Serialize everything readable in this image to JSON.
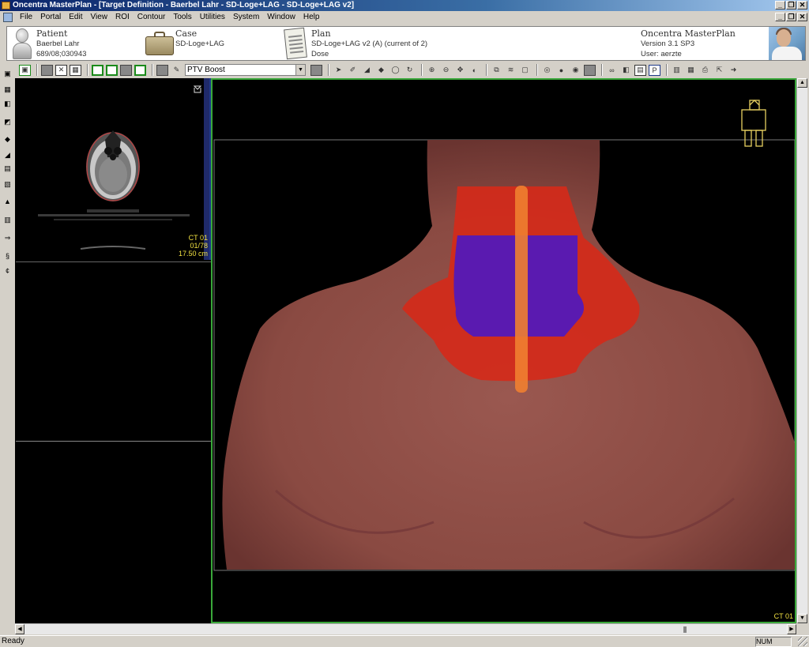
{
  "window": {
    "title": "Oncentra MasterPlan - [Target Definition - Baerbel Lahr - SD-Loge+LAG - SD-Loge+LAG v2]",
    "controls": [
      "_",
      "❐",
      "✕"
    ]
  },
  "menu": {
    "items": [
      "File",
      "Portal",
      "Edit",
      "View",
      "ROI",
      "Contour",
      "Tools",
      "Utilities",
      "System",
      "Window",
      "Help"
    ]
  },
  "header": {
    "patient": {
      "title": "Patient",
      "name": "Baerbel Lahr",
      "id": "689/08;030943"
    },
    "case": {
      "title": "Case",
      "name": "SD-Loge+LAG"
    },
    "plan": {
      "title": "Plan",
      "name": "SD-Loge+LAG v2 (A) (current of 2)",
      "type": "Dose"
    },
    "product": {
      "name": "Oncentra MasterPlan",
      "version": "Version 3.1 SP3",
      "user": "User: aerzte"
    }
  },
  "toolbar": {
    "roi_select_value": "PTV Boost"
  },
  "ct_view": {
    "series": "CT 01",
    "slice": "01/78",
    "position": "17.50 cm"
  },
  "view3d": {
    "series": "CT 01"
  },
  "colors": {
    "skin": "#8a4a42",
    "ptv_outer": "#d42a1a",
    "ptv_boost": "#5a1ab0",
    "spinal_cord": "#f08030",
    "view_border": "#3aa83a"
  },
  "status": {
    "text": "Ready",
    "num": "NUM"
  }
}
